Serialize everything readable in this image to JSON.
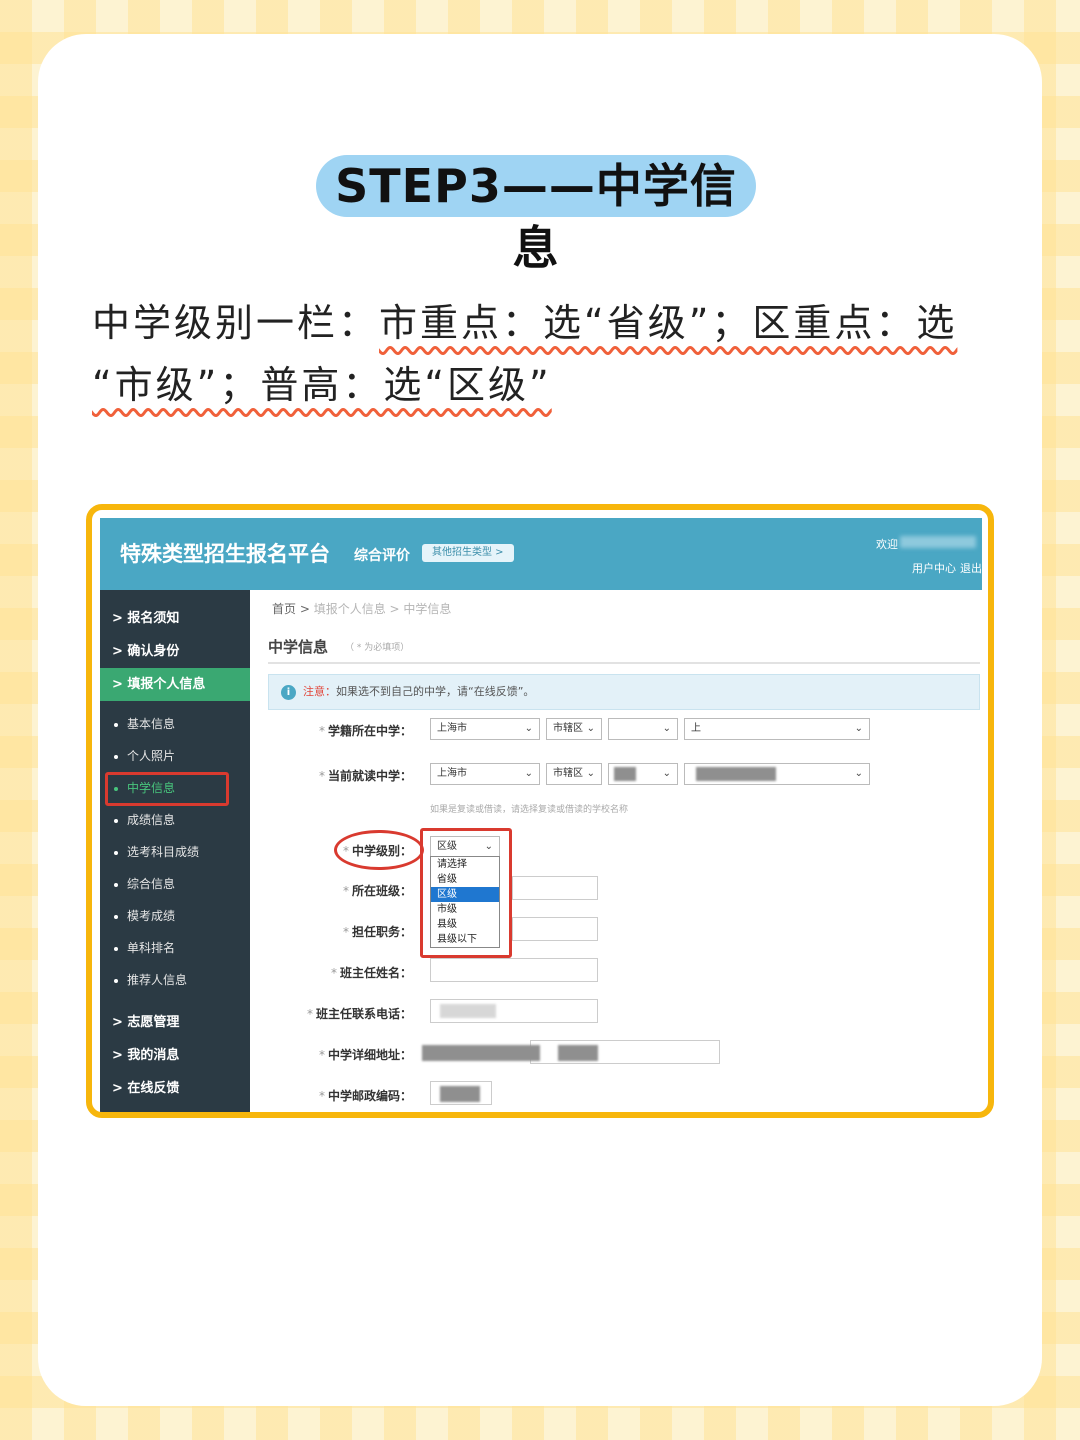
{
  "header": {
    "title": "STEP3——中学信息",
    "instruction_prefix": "中学级别一栏：",
    "instruction_line1_underlined": "市重点：选“省级”；区重点：选",
    "instruction_line2_underlined": "“市级”；普高：选“区级”"
  },
  "app": {
    "brand": "特殊类型招生报名平台",
    "section_label": "综合评价",
    "other_type_button": "其他招生类型 >",
    "welcome": "欢迎",
    "user_center": "用户中心",
    "logout": "退出"
  },
  "sidebar": {
    "top_items": [
      "> 报名须知",
      "> 确认身份",
      "> 填报个人信息"
    ],
    "sub_items": [
      "基本信息",
      "个人照片",
      "中学信息",
      "成绩信息",
      "选考科目成绩",
      "综合信息",
      "模考成绩",
      "单科排名",
      "推荐人信息"
    ],
    "bottom_items": [
      "> 志愿管理",
      "> 我的消息",
      "> 在线反馈"
    ]
  },
  "main": {
    "breadcrumb": {
      "home": "首页 >",
      "mid": "填报个人信息 >",
      "current": "中学信息"
    },
    "page_title": "中学信息",
    "required_note": "（ * 为必填项）",
    "notice_prefix": "注意：",
    "notice_text": "如果选不到自己的中学，请“在线反馈”。",
    "hint": "如果是复读或借读，请选择复读或借读的学校名称",
    "fields": {
      "registered_school": "学籍所在中学：",
      "current_school": "当前就读中学：",
      "school_level": "中学级别：",
      "class": "所在班级：",
      "position": "担任职务：",
      "head_teacher_name": "班主任姓名：",
      "head_teacher_phone": "班主任联系电话：",
      "school_address": "中学详细地址：",
      "school_postcode": "中学邮政编码："
    },
    "selects": {
      "city": "上海市",
      "district": "市辖区",
      "school_prefix": "上"
    },
    "school_level": {
      "selected": "区级",
      "options": [
        "请选择",
        "省级",
        "区级",
        "市级",
        "县级",
        "县级以下"
      ],
      "highlighted": "区级"
    }
  },
  "colors": {
    "accent_blue": "#4aa7c4",
    "active_green": "#3aa872",
    "highlight_red": "#d93a2f",
    "frame_yellow": "#f7b60c"
  }
}
